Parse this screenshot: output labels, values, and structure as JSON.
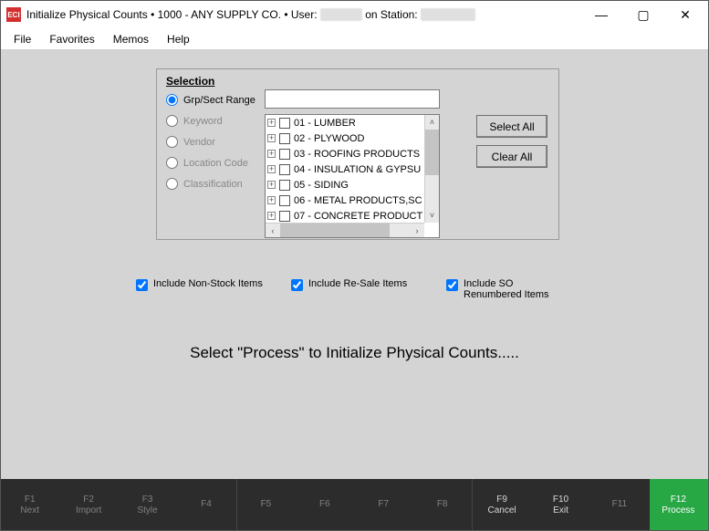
{
  "titlebar": {
    "app_abbrev": "ECI",
    "title": "Initialize Physical Counts",
    "sep": "  •  ",
    "company": "1000 - ANY SUPPLY CO.",
    "user_prefix": "User:",
    "station_prefix": "on Station:"
  },
  "menubar": {
    "file": "File",
    "favorites": "Favorites",
    "memos": "Memos",
    "help": "Help"
  },
  "selection": {
    "title": "Selection",
    "radios": {
      "grpsect": "Grp/Sect Range",
      "keyword": "Keyword",
      "vendor": "Vendor",
      "location": "Location Code",
      "classification": "Classification"
    },
    "search_value": "",
    "tree": [
      "01 - LUMBER",
      "02 - PLYWOOD",
      "03 - ROOFING PRODUCTS",
      "04 - INSULATION & GYPSU",
      "05 - SIDING",
      "06 - METAL PRODUCTS,SC",
      "07 - CONCRETE PRODUCT"
    ],
    "buttons": {
      "select_all": "Select All",
      "clear_all": "Clear All"
    }
  },
  "checkboxes": {
    "nonstock": "Include Non-Stock Items",
    "resale": "Include Re-Sale Items",
    "so_renum": "Include SO Renumbered Items"
  },
  "prompt": "Select \"Process\" to Initialize Physical Counts.....",
  "fkeys": {
    "f1": {
      "k": "F1",
      "l": "Next"
    },
    "f2": {
      "k": "F2",
      "l": "Import"
    },
    "f3": {
      "k": "F3",
      "l": "Style"
    },
    "f4": {
      "k": "F4",
      "l": ""
    },
    "f5": {
      "k": "F5",
      "l": ""
    },
    "f6": {
      "k": "F6",
      "l": ""
    },
    "f7": {
      "k": "F7",
      "l": ""
    },
    "f8": {
      "k": "F8",
      "l": ""
    },
    "f9": {
      "k": "F9",
      "l": "Cancel"
    },
    "f10": {
      "k": "F10",
      "l": "Exit"
    },
    "f11": {
      "k": "F11",
      "l": ""
    },
    "f12": {
      "k": "F12",
      "l": "Process"
    }
  }
}
